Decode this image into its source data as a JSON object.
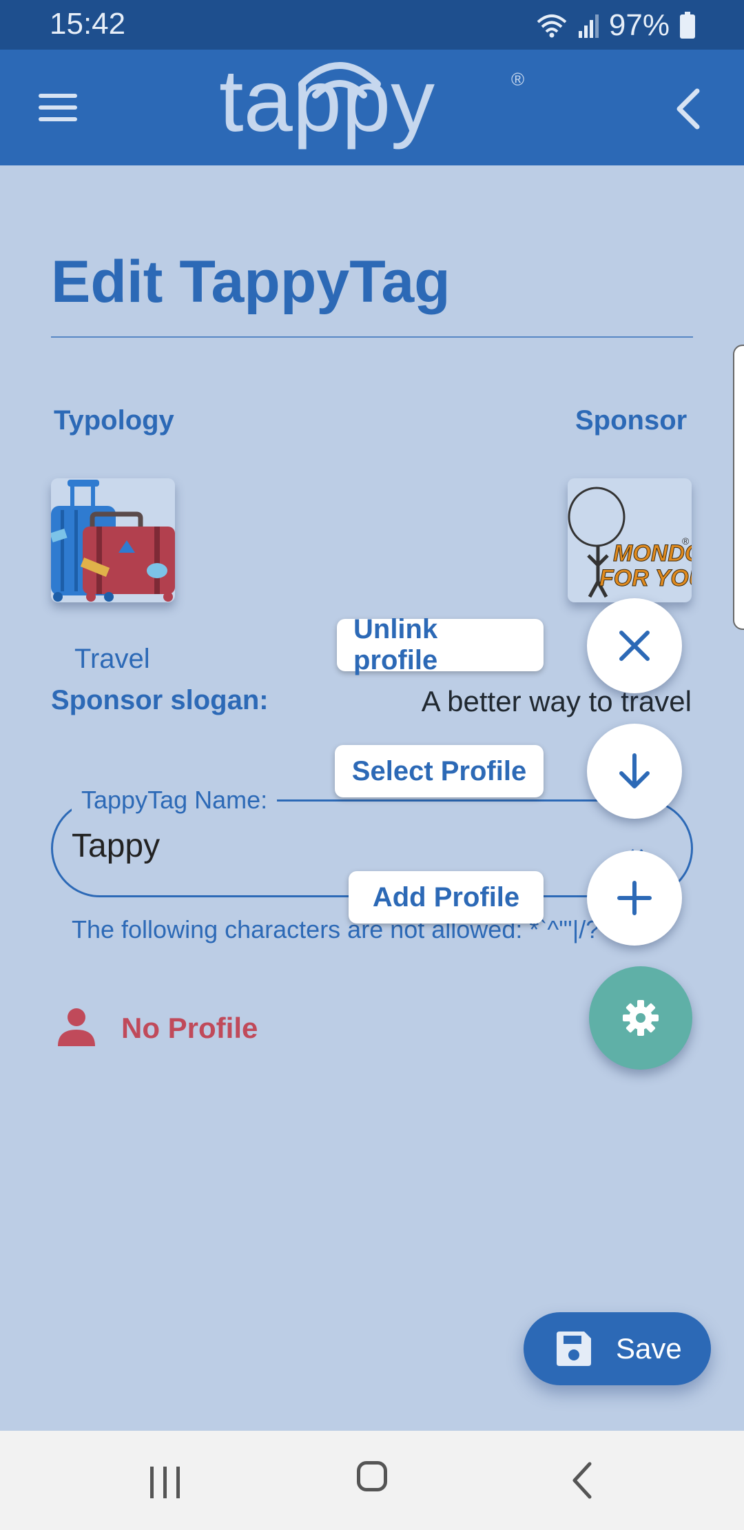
{
  "status_bar": {
    "time": "15:42",
    "battery": "97%"
  },
  "header": {
    "logo_text": "tappy",
    "registered": "®"
  },
  "page": {
    "title": "Edit TappyTag",
    "typology_label": "Typology",
    "sponsor_label": "Sponsor",
    "typology_value": "Travel",
    "sponsor_slogan_label": "Sponsor slogan:",
    "sponsor_slogan_value": "A better way to travel",
    "sponsor_logo_text_1": "MONDO",
    "sponsor_logo_text_2": "FOR YOU",
    "sponsor_logo_registered": "®",
    "name_field_label": "TappyTag Name:",
    "name_field_value": "Tappy",
    "name_hint": "The following characters are not allowed: *`^\"'|/?",
    "profile_status": "No Profile"
  },
  "speed_dial": {
    "unlink_label": "Unlink profile",
    "select_label": "Select Profile",
    "add_label": "Add Profile"
  },
  "save_button": {
    "label": "Save"
  },
  "colors": {
    "primary": "#2c69b6",
    "background": "#bccde5",
    "status_bar": "#1e4f8e",
    "settings_fab": "#5fb0a7",
    "no_profile": "#c04a5a"
  },
  "icons": [
    "menu-icon",
    "back-icon",
    "close-icon",
    "arrow-down-icon",
    "plus-icon",
    "gear-icon",
    "person-icon",
    "save-icon"
  ]
}
